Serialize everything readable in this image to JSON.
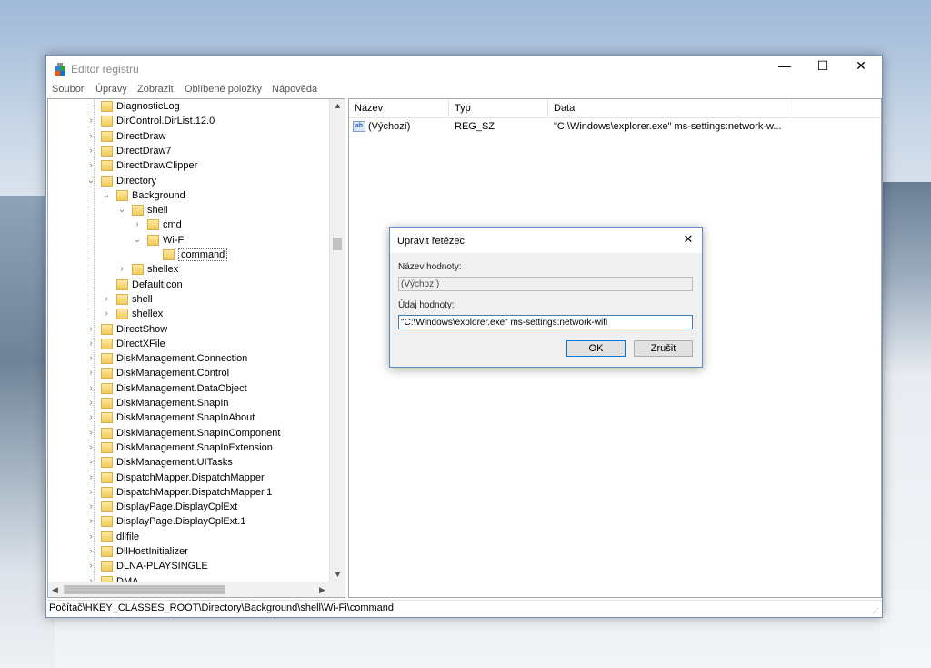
{
  "window": {
    "title": "Editor registru",
    "controls": {
      "minimize": "—",
      "maximize": "☐",
      "close": "✕"
    }
  },
  "menu": [
    "Soubor",
    "Úpravy",
    "Zobrazit",
    "Oblíbené položky",
    "Nápověda"
  ],
  "tree": [
    {
      "label": "DiagnosticLog",
      "depth": 0,
      "chevron": ""
    },
    {
      "label": "DirControl.DirList.12.0",
      "depth": 0,
      "chevron": ">"
    },
    {
      "label": "DirectDraw",
      "depth": 0,
      "chevron": ">"
    },
    {
      "label": "DirectDraw7",
      "depth": 0,
      "chevron": ">"
    },
    {
      "label": "DirectDrawClipper",
      "depth": 0,
      "chevron": ">"
    },
    {
      "label": "Directory",
      "depth": 0,
      "chevron": "v"
    },
    {
      "label": "Background",
      "depth": 1,
      "chevron": "v"
    },
    {
      "label": "shell",
      "depth": 2,
      "chevron": "v"
    },
    {
      "label": "cmd",
      "depth": 3,
      "chevron": ">"
    },
    {
      "label": "Wi-Fi",
      "depth": 3,
      "chevron": "v"
    },
    {
      "label": "command",
      "depth": 4,
      "chevron": "",
      "selected": true
    },
    {
      "label": "shellex",
      "depth": 2,
      "chevron": ">"
    },
    {
      "label": "DefaultIcon",
      "depth": 1,
      "chevron": ""
    },
    {
      "label": "shell",
      "depth": 1,
      "chevron": ">"
    },
    {
      "label": "shellex",
      "depth": 1,
      "chevron": ">"
    },
    {
      "label": "DirectShow",
      "depth": 0,
      "chevron": ">"
    },
    {
      "label": "DirectXFile",
      "depth": 0,
      "chevron": ">"
    },
    {
      "label": "DiskManagement.Connection",
      "depth": 0,
      "chevron": ">"
    },
    {
      "label": "DiskManagement.Control",
      "depth": 0,
      "chevron": ">"
    },
    {
      "label": "DiskManagement.DataObject",
      "depth": 0,
      "chevron": ">"
    },
    {
      "label": "DiskManagement.SnapIn",
      "depth": 0,
      "chevron": ">"
    },
    {
      "label": "DiskManagement.SnapInAbout",
      "depth": 0,
      "chevron": ">"
    },
    {
      "label": "DiskManagement.SnapInComponent",
      "depth": 0,
      "chevron": ">"
    },
    {
      "label": "DiskManagement.SnapInExtension",
      "depth": 0,
      "chevron": ">"
    },
    {
      "label": "DiskManagement.UITasks",
      "depth": 0,
      "chevron": ">"
    },
    {
      "label": "DispatchMapper.DispatchMapper",
      "depth": 0,
      "chevron": ">"
    },
    {
      "label": "DispatchMapper.DispatchMapper.1",
      "depth": 0,
      "chevron": ">"
    },
    {
      "label": "DisplayPage.DisplayCplExt",
      "depth": 0,
      "chevron": ">"
    },
    {
      "label": "DisplayPage.DisplayCplExt.1",
      "depth": 0,
      "chevron": ">"
    },
    {
      "label": "dllfile",
      "depth": 0,
      "chevron": ">"
    },
    {
      "label": "DllHostInitializer",
      "depth": 0,
      "chevron": ">"
    },
    {
      "label": "DLNA-PLAYSINGLE",
      "depth": 0,
      "chevron": ">"
    },
    {
      "label": "DMA...",
      "depth": 0,
      "chevron": ">"
    }
  ],
  "list": {
    "columns": [
      "Název",
      "Typ",
      "Data"
    ],
    "rows": [
      {
        "icon": "ab",
        "name": "(Výchozí)",
        "type": "REG_SZ",
        "data": "\"C:\\Windows\\explorer.exe\" ms-settings:network-w..."
      }
    ]
  },
  "status": {
    "path": "Počítač\\HKEY_CLASSES_ROOT\\Directory\\Background\\shell\\Wi-Fi\\command"
  },
  "dialog": {
    "title": "Upravit řetězec",
    "close": "✕",
    "name_label": "Název hodnoty:",
    "name_value": "(Výchozí)",
    "data_label": "Údaj hodnoty:",
    "data_value": "\"C:\\Windows\\explorer.exe\" ms-settings:network-wifi",
    "ok": "OK",
    "cancel": "Zrušit"
  },
  "colors": {
    "accent": "#0078d7",
    "folder": "#f3c95a"
  }
}
